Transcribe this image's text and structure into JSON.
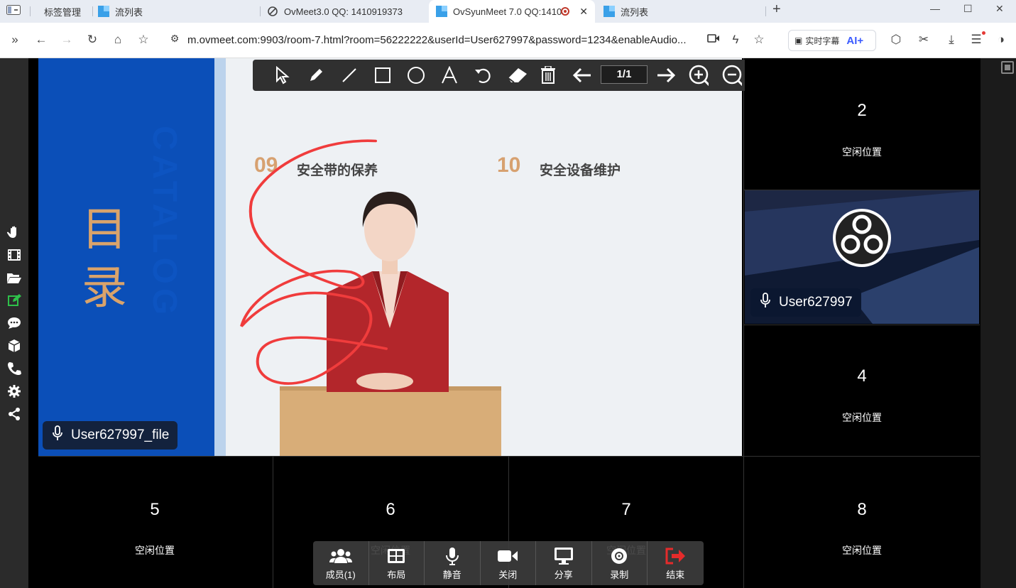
{
  "browser": {
    "tabs": [
      {
        "label": "标签管理"
      },
      {
        "label": "流列表"
      },
      {
        "label": "OvMeet3.0 QQ: 1410919373"
      },
      {
        "label": "OvSyunMeet 7.0 QQ:1410"
      },
      {
        "label": "流列表"
      }
    ],
    "new_tab": "+",
    "url": "m.ovmeet.com:9903/room-7.html?room=56222222&userId=User627997&password=1234&enableAudio...",
    "caption_label": "实时字幕",
    "ai_label": "AI+"
  },
  "whiteboard": {
    "page_indicator": "1/1"
  },
  "slide": {
    "heading_chars": [
      "目",
      "录"
    ],
    "watermark": "CATALOG",
    "items": [
      {
        "num": "09",
        "text": "安全带的保养"
      },
      {
        "num": "10",
        "text": "安全设备维护"
      }
    ]
  },
  "main_video": {
    "user_label": "User627997_file"
  },
  "obs_video": {
    "user_label": "User627997"
  },
  "slots": [
    {
      "num": "2",
      "status": "空闲位置"
    },
    {
      "num": "4",
      "status": "空闲位置"
    },
    {
      "num": "5",
      "status": "空闲位置"
    },
    {
      "num": "6",
      "status": "空闲位置"
    },
    {
      "num": "7",
      "status": "空闲位置"
    },
    {
      "num": "8",
      "status": "空闲位置"
    }
  ],
  "controls": {
    "members": "成员(1)",
    "layout": "布局",
    "mute": "静音",
    "camera_off": "关闭",
    "share": "分享",
    "record": "录制",
    "end": "结束"
  },
  "colors": {
    "end_red": "#e52b2b",
    "slide_blue": "#0b4fb8",
    "accent_orange": "#d7a170",
    "annotation_red": "#f03c3c"
  }
}
